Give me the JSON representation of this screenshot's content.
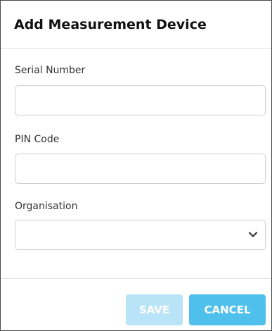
{
  "dialog": {
    "title": "Add Measurement Device"
  },
  "fields": {
    "serial_number": {
      "label": "Serial Number",
      "value": "",
      "placeholder": ""
    },
    "pin_code": {
      "label": "PIN Code",
      "value": "",
      "placeholder": ""
    },
    "organisation": {
      "label": "Organisation",
      "selected": ""
    }
  },
  "buttons": {
    "save": "SAVE",
    "cancel": "CANCEL"
  },
  "colors": {
    "save_disabled": "#b9e3f6",
    "cancel": "#4fc0ec",
    "border": "#4a4a4a"
  },
  "icons": {
    "organisation_dropdown": "chevron-down-icon"
  }
}
